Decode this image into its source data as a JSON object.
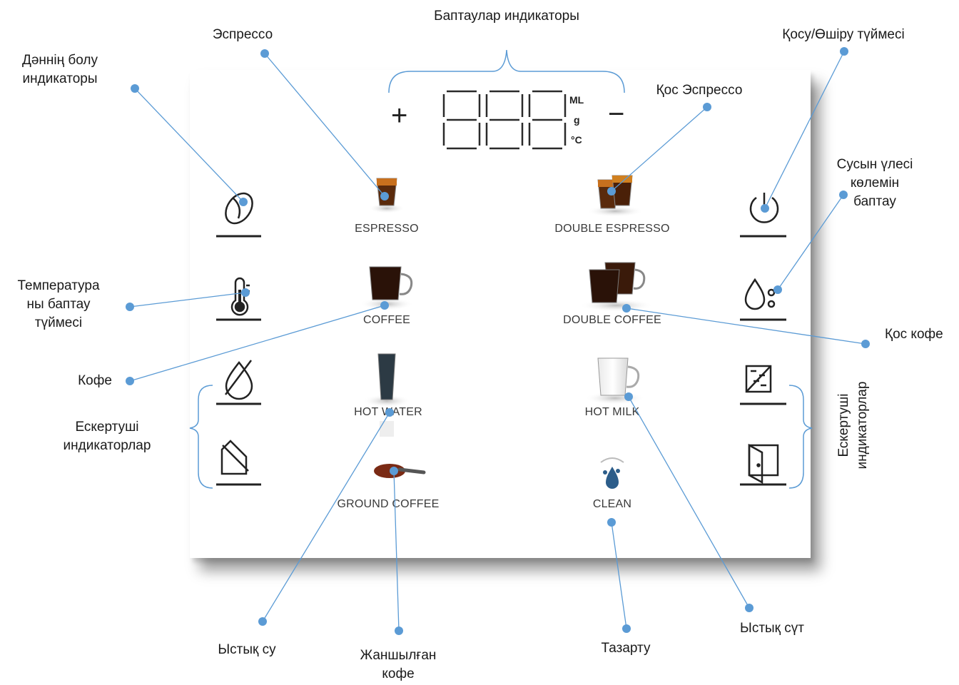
{
  "callouts": {
    "settings_indicator": "Баптаулар индикаторы",
    "espresso": "Эспрессо",
    "power_button": "Қосу/Өшіру түймесі",
    "grind_indicator_line1": "Дәннің болу",
    "grind_indicator_line2": "индикаторы",
    "double_espresso": "Қос Эспрессо",
    "volume_line1": "Сусын үлесі",
    "volume_line2": "көлемін",
    "volume_line3": "баптау",
    "temperature_line1": "Температура",
    "temperature_line2": "ны баптау",
    "temperature_line3": "түймесі",
    "double_coffee": "Қос кофе",
    "coffee": "Кофе",
    "warnings_left_line1": "Ескертуші",
    "warnings_left_line2": "индикаторлар",
    "warnings_right_line1": "Ескертуші",
    "warnings_right_line2": "индикаторлар",
    "hot_water": "Ыстық су",
    "ground_coffee_line1": "Жаншылған",
    "ground_coffee_line2": "кофе",
    "clean": "Тазарту",
    "hot_milk": "Ыстық сүт"
  },
  "panel": {
    "display": {
      "plus": "+",
      "minus": "−",
      "digits": "888",
      "unit_ml": "ML",
      "unit_g": "g",
      "unit_c": "°C"
    },
    "buttons": {
      "espresso": "ESPRESSO",
      "double_espresso": "DOUBLE ESPRESSO",
      "coffee": "COFFEE",
      "double_coffee": "DOUBLE COFFEE",
      "hot_water": "HOT WATER",
      "hot_milk": "HOT MILK",
      "ground_coffee": "GROUND COFFEE",
      "clean": "CLEAN"
    }
  },
  "colors": {
    "callout_line": "#5b9bd5",
    "callout_dot": "#5b9bd5",
    "coffee_dark": "#2a1208",
    "espresso_crema": "#c8701e"
  },
  "icons": [
    "coffee-bean-icon",
    "thermometer-icon",
    "no-water-icon",
    "grounds-drawer-icon",
    "power-icon",
    "water-drop-icon",
    "descale-icon",
    "door-open-icon"
  ]
}
